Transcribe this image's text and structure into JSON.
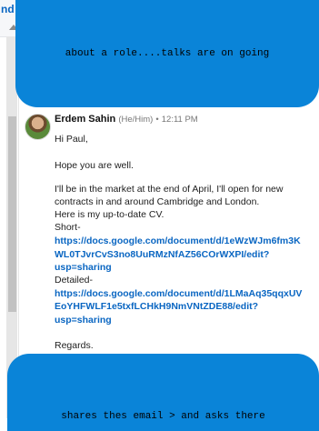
{
  "header": {
    "back_label": "nd"
  },
  "overlays": {
    "top_text": "about a role....talks are on going",
    "bottom_text": "shares thes email > and asks there"
  },
  "message": {
    "sender_name": "Erdem Sahin",
    "pronouns": "(He/Him)",
    "separator": "•",
    "time": "12:11 PM",
    "lines": {
      "greeting": "Hi Paul,",
      "hope": "Hope you are well.",
      "intro1": "I'll be in the market at the end of April, I'll open for new",
      "intro2": "contracts in and around Cambridge and London.",
      "intro3": "Here is my up-to-date CV.",
      "short_label": "Short-",
      "short_link1": "https://docs.google.com/document/d/1eWzWJm6fm3K",
      "short_link2": "WL0TJvrCvS3no8UuRMzNfAZ56COrWXPI/edit?",
      "short_link3": "usp=sharing",
      "detailed_label": "Detailed-",
      "detailed_link1": "https://docs.google.com/document/d/1LMaAq35qqxUV",
      "detailed_link2": "EoYHFWLF1e5txfLCHkH9NmVNtZDE88/edit?",
      "detailed_link3": "usp=sharing",
      "regards": "Regards."
    }
  },
  "colors": {
    "bubble": "#0a84d8",
    "link": "#0a66c2"
  }
}
